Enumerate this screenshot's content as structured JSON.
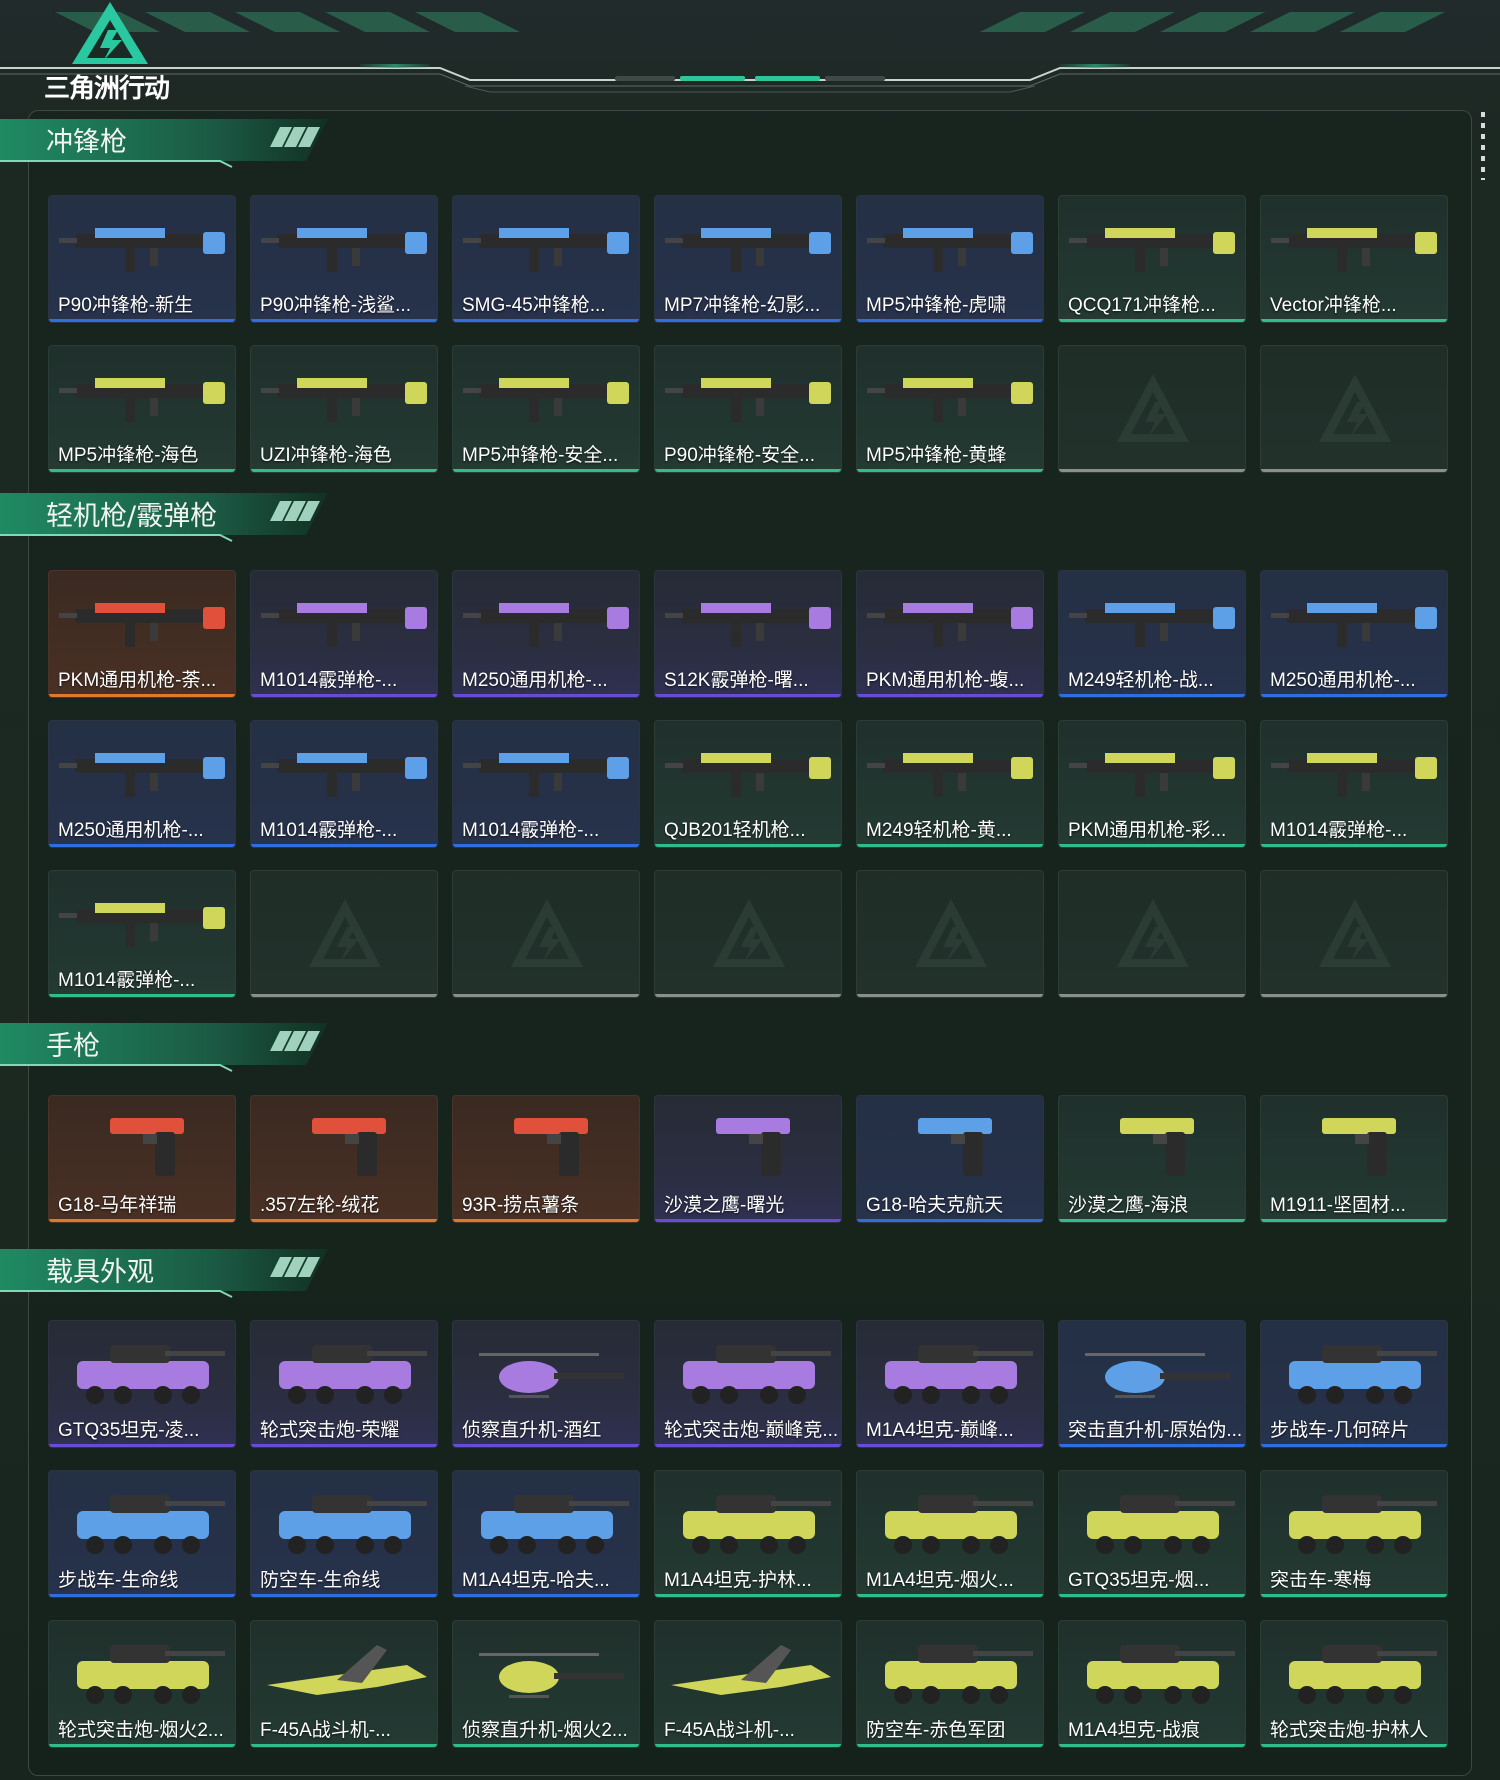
{
  "app": {
    "logo_text": "三角洲行动"
  },
  "colors": {
    "accent": "#2ec9a0",
    "rarity_purple": "#6a4bd6",
    "rarity_blue": "#2f6ee0",
    "rarity_green": "#2fbd8e",
    "rarity_orange": "#e07a2a",
    "rarity_none": "#8a8f8c"
  },
  "sections": [
    {
      "title": "冲锋枪",
      "items": [
        {
          "name": "P90冲锋枪-新生",
          "rarity": "blue",
          "icon": "smg-icon"
        },
        {
          "name": "P90冲锋枪-浅鲨...",
          "rarity": "blue",
          "icon": "smg-icon"
        },
        {
          "name": "SMG-45冲锋枪...",
          "rarity": "blue",
          "icon": "smg-icon"
        },
        {
          "name": "MP7冲锋枪-幻影...",
          "rarity": "blue",
          "icon": "smg-icon"
        },
        {
          "name": "MP5冲锋枪-虎啸",
          "rarity": "blue",
          "icon": "smg-icon"
        },
        {
          "name": "QCQ171冲锋枪...",
          "rarity": "green",
          "icon": "smg-icon"
        },
        {
          "name": "Vector冲锋枪...",
          "rarity": "green",
          "icon": "smg-icon"
        },
        {
          "name": "MP5冲锋枪-海色",
          "rarity": "green",
          "icon": "smg-icon"
        },
        {
          "name": "UZI冲锋枪-海色",
          "rarity": "green",
          "icon": "smg-icon"
        },
        {
          "name": "MP5冲锋枪-安全...",
          "rarity": "green",
          "icon": "smg-icon"
        },
        {
          "name": "P90冲锋枪-安全...",
          "rarity": "green",
          "icon": "smg-icon"
        },
        {
          "name": "MP5冲锋枪-黄蜂",
          "rarity": "green",
          "icon": "smg-icon"
        },
        {
          "name": "",
          "rarity": "none",
          "icon": "empty-slot-icon"
        },
        {
          "name": "",
          "rarity": "none",
          "icon": "empty-slot-icon"
        }
      ]
    },
    {
      "title": "轻机枪/霰弹枪",
      "items": [
        {
          "name": "PKM通用机枪-荼...",
          "rarity": "orange",
          "icon": "lmg-icon"
        },
        {
          "name": "M1014霰弹枪-...",
          "rarity": "purple",
          "icon": "shotgun-icon"
        },
        {
          "name": "M250通用机枪-...",
          "rarity": "purple",
          "icon": "lmg-icon"
        },
        {
          "name": "S12K霰弹枪-曙...",
          "rarity": "purple",
          "icon": "shotgun-icon"
        },
        {
          "name": "PKM通用机枪-蝮...",
          "rarity": "purple",
          "icon": "lmg-icon"
        },
        {
          "name": "M249轻机枪-战...",
          "rarity": "blue",
          "icon": "lmg-icon"
        },
        {
          "name": "M250通用机枪-...",
          "rarity": "blue",
          "icon": "lmg-icon"
        },
        {
          "name": "M250通用机枪-...",
          "rarity": "blue",
          "icon": "lmg-icon"
        },
        {
          "name": "M1014霰弹枪-...",
          "rarity": "blue",
          "icon": "shotgun-icon"
        },
        {
          "name": "M1014霰弹枪-...",
          "rarity": "blue",
          "icon": "shotgun-icon"
        },
        {
          "name": "QJB201轻机枪...",
          "rarity": "green",
          "icon": "lmg-icon"
        },
        {
          "name": "M249轻机枪-黄...",
          "rarity": "green",
          "icon": "lmg-icon"
        },
        {
          "name": "PKM通用机枪-彩...",
          "rarity": "green",
          "icon": "lmg-icon"
        },
        {
          "name": "M1014霰弹枪-...",
          "rarity": "green",
          "icon": "shotgun-icon"
        },
        {
          "name": "M1014霰弹枪-...",
          "rarity": "green",
          "icon": "shotgun-icon"
        },
        {
          "name": "",
          "rarity": "none",
          "icon": "empty-slot-icon"
        },
        {
          "name": "",
          "rarity": "none",
          "icon": "empty-slot-icon"
        },
        {
          "name": "",
          "rarity": "none",
          "icon": "empty-slot-icon"
        },
        {
          "name": "",
          "rarity": "none",
          "icon": "empty-slot-icon"
        },
        {
          "name": "",
          "rarity": "none",
          "icon": "empty-slot-icon"
        },
        {
          "name": "",
          "rarity": "none",
          "icon": "empty-slot-icon"
        }
      ]
    },
    {
      "title": "手枪",
      "items": [
        {
          "name": "G18-马年祥瑞",
          "rarity": "orange",
          "icon": "pistol-icon"
        },
        {
          "name": ".357左轮-绒花",
          "rarity": "orange",
          "icon": "revolver-icon"
        },
        {
          "name": "93R-捞点薯条",
          "rarity": "orange",
          "icon": "pistol-icon"
        },
        {
          "name": "沙漠之鹰-曙光",
          "rarity": "purple",
          "icon": "pistol-icon"
        },
        {
          "name": "G18-哈夫克航天",
          "rarity": "blue",
          "icon": "pistol-icon"
        },
        {
          "name": "沙漠之鹰-海浪",
          "rarity": "green",
          "icon": "pistol-icon"
        },
        {
          "name": "M1911-坚固材...",
          "rarity": "green",
          "icon": "pistol-icon"
        }
      ]
    },
    {
      "title": "载具外观",
      "items": [
        {
          "name": "GTQ35坦克-凌...",
          "rarity": "purple",
          "icon": "tank-icon"
        },
        {
          "name": "轮式突击炮-荣耀",
          "rarity": "purple",
          "icon": "armored-car-icon"
        },
        {
          "name": "侦察直升机-酒红",
          "rarity": "purple",
          "icon": "helicopter-icon"
        },
        {
          "name": "轮式突击炮-巅峰竞...",
          "rarity": "purple",
          "icon": "armored-car-icon"
        },
        {
          "name": "M1A4坦克-巅峰...",
          "rarity": "purple",
          "icon": "tank-icon"
        },
        {
          "name": "突击直升机-原始伪...",
          "rarity": "blue",
          "icon": "helicopter-icon"
        },
        {
          "name": "步战车-几何碎片",
          "rarity": "blue",
          "icon": "ifv-icon"
        },
        {
          "name": "步战车-生命线",
          "rarity": "blue",
          "icon": "ifv-icon"
        },
        {
          "name": "防空车-生命线",
          "rarity": "blue",
          "icon": "ifv-icon"
        },
        {
          "name": "M1A4坦克-哈夫...",
          "rarity": "blue",
          "icon": "tank-icon"
        },
        {
          "name": "M1A4坦克-护林...",
          "rarity": "green",
          "icon": "tank-icon"
        },
        {
          "name": "M1A4坦克-烟火...",
          "rarity": "green",
          "icon": "tank-icon"
        },
        {
          "name": "GTQ35坦克-烟...",
          "rarity": "green",
          "icon": "tank-icon"
        },
        {
          "name": "突击车-寒梅",
          "rarity": "green",
          "icon": "armored-car-icon"
        },
        {
          "name": "轮式突击炮-烟火2...",
          "rarity": "green",
          "icon": "armored-car-icon"
        },
        {
          "name": "F-45A战斗机-...",
          "rarity": "green",
          "icon": "jet-icon"
        },
        {
          "name": "侦察直升机-烟火2...",
          "rarity": "green",
          "icon": "helicopter-icon"
        },
        {
          "name": "F-45A战斗机-...",
          "rarity": "green",
          "icon": "jet-icon"
        },
        {
          "name": "防空车-赤色军团",
          "rarity": "green",
          "icon": "ifv-icon"
        },
        {
          "name": "M1A4坦克-战痕",
          "rarity": "green",
          "icon": "tank-icon"
        },
        {
          "name": "轮式突击炮-护林人",
          "rarity": "green",
          "icon": "armored-car-icon"
        }
      ]
    }
  ]
}
